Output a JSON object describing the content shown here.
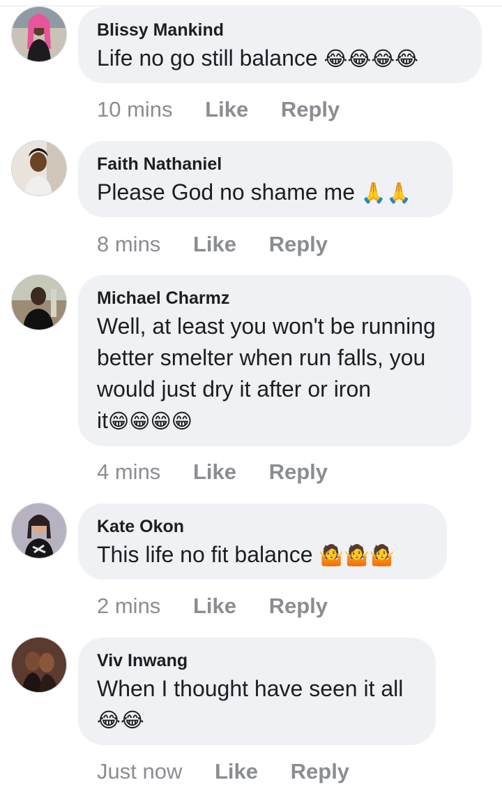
{
  "comments": [
    {
      "author": "Blissy Mankind",
      "text": "Life no go still balance",
      "emoji": "😂😂😂😂",
      "time": "10 mins",
      "like_label": "Like",
      "reply_label": "Reply"
    },
    {
      "author": "Faith Nathaniel",
      "text": "Please God no shame me",
      "emoji": "🙏🙏",
      "time": "8 mins",
      "like_label": "Like",
      "reply_label": "Reply"
    },
    {
      "author": "Michael Charmz",
      "text_lines": [
        "Well, at least you won't be running",
        "better smelter when run falls, you",
        "would just dry it after or iron"
      ],
      "text_last": "it",
      "emoji": "😁😁😁😁",
      "time": "4 mins",
      "like_label": "Like",
      "reply_label": "Reply"
    },
    {
      "author": "Kate Okon",
      "text": "This life no fit balance",
      "emoji": "🤷🤷🤷",
      "time": "2 mins",
      "like_label": "Like",
      "reply_label": "Reply"
    },
    {
      "author": "Viv Inwang",
      "text": "When I thought have seen it all",
      "emoji": "😂😂",
      "time": "Just now",
      "like_label": "Like",
      "reply_label": "Reply"
    }
  ],
  "colors": {
    "bubble": "#eff1f5",
    "meta": "#8a8d91",
    "text": "#1c1e21"
  }
}
